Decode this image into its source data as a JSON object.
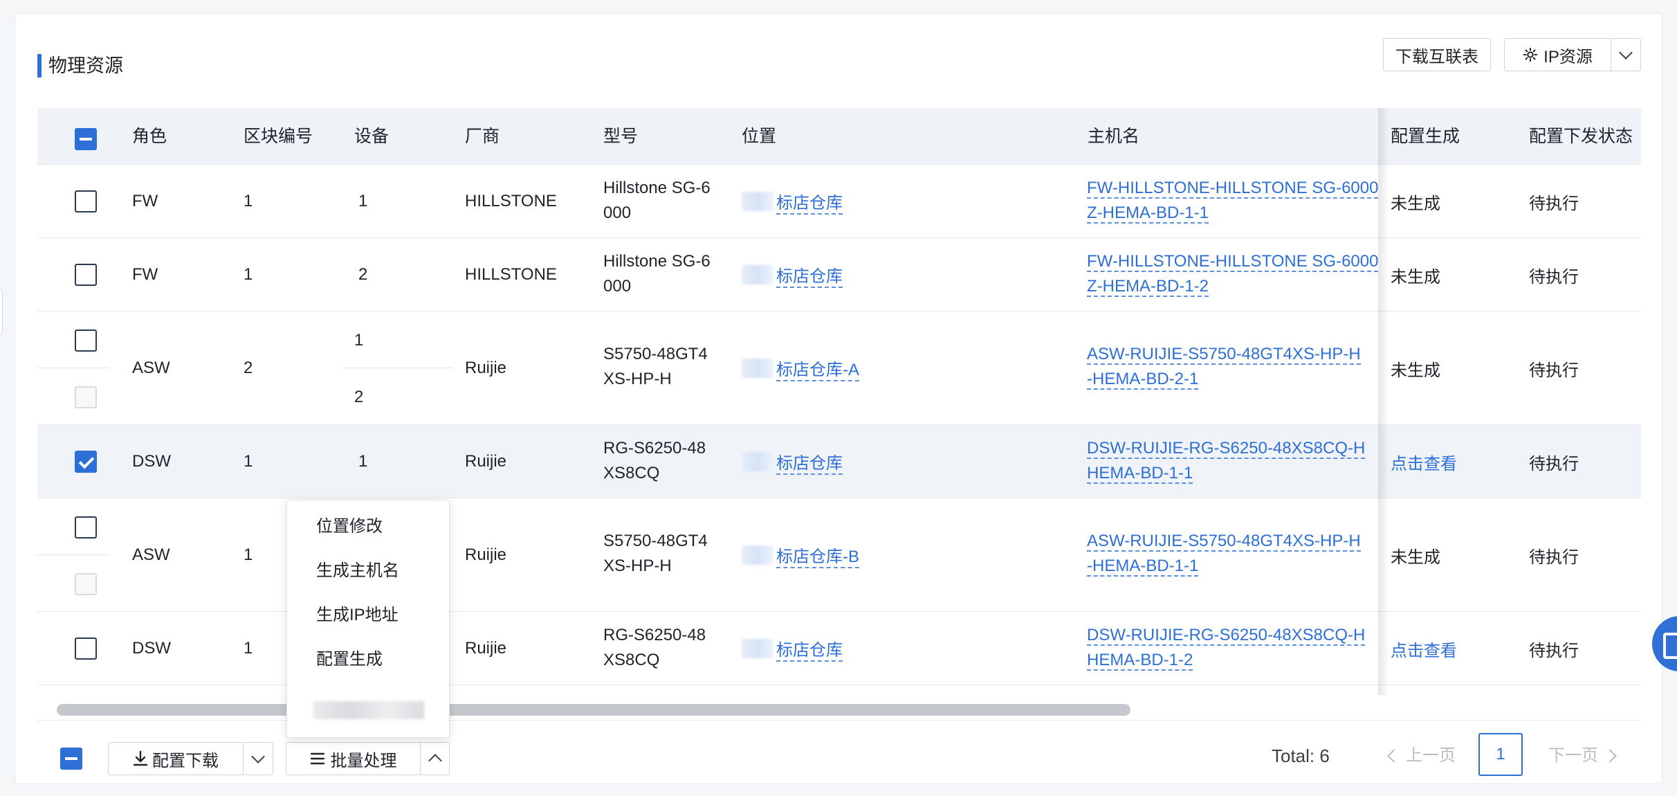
{
  "section": {
    "title": "物理资源",
    "buttons": {
      "download_interconnect": "下载互联表",
      "ip_resource": "IP资源"
    }
  },
  "table": {
    "headers": {
      "role": "角色",
      "block_no": "区块编号",
      "device": "设备",
      "vendor": "厂商",
      "model": "型号",
      "location": "位置",
      "hostname": "主机名",
      "config_gen": "配置生成",
      "config_status": "配置下发状态"
    },
    "rows": [
      {
        "role": "FW",
        "block": "1",
        "devices": [
          "1"
        ],
        "vendor": "HILLSTONE",
        "model": "Hillstone SG-6000",
        "location": "标店仓库",
        "hostname": "FW-HILLSTONE-HILLSTONE SG-6000-Z-HEMA-BD-1-1",
        "config": "未生成",
        "status": "待执行"
      },
      {
        "role": "FW",
        "block": "1",
        "devices": [
          "2"
        ],
        "vendor": "HILLSTONE",
        "model": "Hillstone SG-6000",
        "location": "标店仓库",
        "hostname": "FW-HILLSTONE-HILLSTONE SG-6000-Z-HEMA-BD-1-2",
        "config": "未生成",
        "status": "待执行"
      },
      {
        "role": "ASW",
        "block": "2",
        "devices": [
          "1",
          "2"
        ],
        "vendor": "Ruijie",
        "model": "S5750-48GT4XS-HP-H",
        "location": "标店仓库-A",
        "hostname": "ASW-RUIJIE-S5750-48GT4XS-HP-H-HEMA-BD-2-1",
        "config": "未生成",
        "status": "待执行"
      },
      {
        "role": "DSW",
        "block": "1",
        "devices": [
          "1"
        ],
        "vendor": "Ruijie",
        "model": "RG-S6250-48XS8CQ",
        "location": "标店仓库",
        "hostname": "DSW-RUIJIE-RG-S6250-48XS8CQ-HEMA-BD-1-1",
        "config": "点击查看",
        "status": "待执行"
      },
      {
        "role": "ASW",
        "block": "1",
        "devices": [],
        "vendor": "Ruijie",
        "model": "S5750-48GT4XS-HP-H",
        "location": "标店仓库-B",
        "hostname": "ASW-RUIJIE-S5750-48GT4XS-HP-H-HEMA-BD-1-1",
        "config": "未生成",
        "status": "待执行"
      },
      {
        "role": "DSW",
        "block": "1",
        "devices": [],
        "vendor": "Ruijie",
        "model": "RG-S6250-48XS8CQ",
        "location": "标店仓库",
        "hostname": "DSW-RUIJIE-RG-S6250-48XS8CQ-HEMA-BD-1-2",
        "config": "点击查看",
        "status": "待执行"
      }
    ]
  },
  "model_lines": {
    "hillstone": [
      "Hillstone SG-6",
      "000"
    ],
    "s5750": [
      "S5750-48GT4",
      "XS-HP-H"
    ],
    "rg": [
      "RG-S6250-48",
      "XS8CQ"
    ]
  },
  "hostname_lines": {
    "r1": [
      "FW-HILLSTONE-HILLSTONE SG-6000",
      "Z-HEMA-BD-1-1"
    ],
    "r2": [
      "FW-HILLSTONE-HILLSTONE SG-6000",
      "Z-HEMA-BD-1-2"
    ],
    "r3": [
      "ASW-RUIJIE-S5750-48GT4XS-HP-H",
      "-HEMA-BD-2-1"
    ],
    "r4": [
      "DSW-RUIJIE-RG-S6250-48XS8CQ-H",
      "HEMA-BD-1-1"
    ],
    "r5": [
      "ASW-RUIJIE-S5750-48GT4XS-HP-H",
      "-HEMA-BD-1-1"
    ],
    "r6": [
      "DSW-RUIJIE-RG-S6250-48XS8CQ-H",
      "HEMA-BD-1-2"
    ]
  },
  "footer": {
    "config_download": "配置下载",
    "batch": "批量处理",
    "total": "Total: 6",
    "prev": "上一页",
    "page": "1",
    "next": "下一页"
  },
  "batch_menu": {
    "items": [
      "位置修改",
      "生成主机名",
      "生成IP地址",
      "配置生成"
    ]
  },
  "colors": {
    "accent": "#2d6fd6",
    "header_bg": "#eff2f6",
    "selected_row": "#f0f3f8"
  }
}
